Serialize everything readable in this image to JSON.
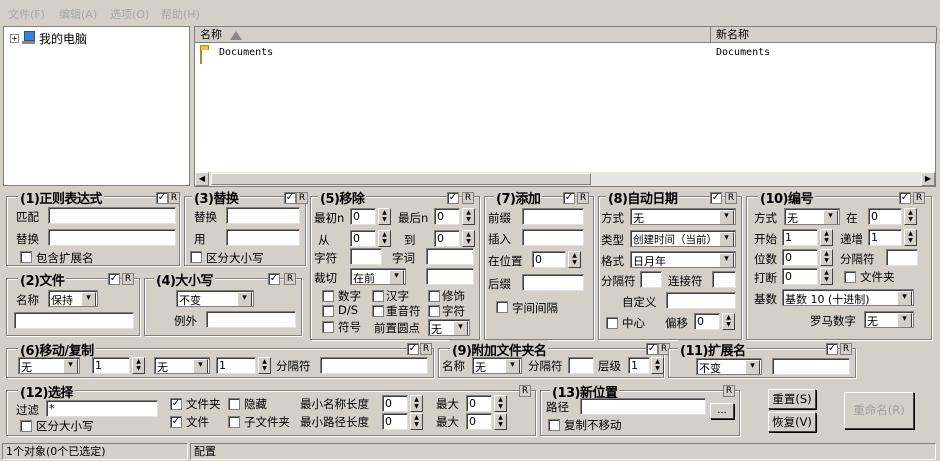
{
  "menu": [
    "文件(F)",
    "编辑(A)",
    "选项(O)",
    "帮助(H)"
  ],
  "tree": {
    "root": "我的电脑",
    "expander": "+"
  },
  "list": {
    "col_name": "名称",
    "col_newname": "新名称",
    "rows": [
      {
        "name": "Documents",
        "newname": "Documents"
      }
    ]
  },
  "regex": {
    "title": "(1)正则表达式",
    "match": "匹配",
    "replace": "替换",
    "incl_ext": "包含扩展名",
    "r": "R"
  },
  "file": {
    "title": "(2)文件",
    "name_label": "名称",
    "name_value": "保持",
    "r": "R"
  },
  "repl": {
    "title": "(3)替换",
    "replace": "替换",
    "with": "用",
    "case": "区分大小写",
    "r": "R"
  },
  "case": {
    "title": "(4)大小写",
    "value": "不变",
    "except": "例外",
    "r": "R"
  },
  "remove": {
    "title": "(5)移除",
    "first_n": "最初n",
    "last_n": "最后n",
    "from": "从",
    "to": "到",
    "chars": "字符",
    "words": "字词",
    "crop": "裁切",
    "crop_value": "在前",
    "digits": "数字",
    "chinese": "汉字",
    "modifiers": "修饰",
    "ds": "D/S",
    "accents": "重音符",
    "chars2": "字符",
    "symbols": "符号",
    "lead_dots": "前置圆点",
    "lead_dots_value": "无",
    "first_n_val": "0",
    "last_n_val": "0",
    "from_val": "0",
    "to_val": "0",
    "r": "R"
  },
  "add": {
    "title": "(7)添加",
    "prefix": "前缀",
    "insert": "插入",
    "at_pos": "在位置",
    "at_pos_val": "0",
    "suffix": "后缀",
    "word_space": "字间间隔",
    "r": "R"
  },
  "autodate": {
    "title": "(8)自动日期",
    "mode": "方式",
    "mode_val": "无",
    "type": "类型",
    "type_val": "创建时间（当前）",
    "format": "格式",
    "format_val": "日月年",
    "sep": "分隔符",
    "join": "连接符",
    "custom": "自定义",
    "center": "中心",
    "offset": "偏移",
    "offset_val": "0",
    "r": "R"
  },
  "number": {
    "title": "(10)编号",
    "mode": "方式",
    "mode_val": "无",
    "at": "在",
    "at_val": "0",
    "start": "开始",
    "start_val": "1",
    "incr": "递增",
    "incr_val": "1",
    "pad": "位数",
    "pad_val": "0",
    "sep": "分隔符",
    "break": "打断",
    "break_val": "0",
    "folder": "文件夹",
    "base": "基数",
    "base_val": "基数 10 (十进制)",
    "roman": "罗马数字",
    "roman_val": "无",
    "r": "R"
  },
  "move": {
    "title": "(6)移动/复制",
    "sel1": "无",
    "val1": "1",
    "sel2": "无",
    "val2": "1",
    "sep": "分隔符",
    "r": "R"
  },
  "append": {
    "title": "(9)附加文件夹名",
    "name": "名称",
    "name_val": "无",
    "sep": "分隔符",
    "level": "层级",
    "level_val": "1",
    "r": "R"
  },
  "ext": {
    "title": "(11)扩展名",
    "value": "不变",
    "r": "R"
  },
  "select": {
    "title": "(12)选择",
    "filter": "过滤",
    "filter_val": "*",
    "case": "区分大小写",
    "folders": "文件夹",
    "files": "文件",
    "hidden": "隐藏",
    "subfolders": "子文件夹",
    "min_name": "最小名称长度",
    "min_path": "最小路径长度",
    "max": "最大",
    "zero": "0",
    "r": "R"
  },
  "newloc": {
    "title": "(13)新位置",
    "path": "路径",
    "browse": "...",
    "copy": "复制不移动",
    "r": "R"
  },
  "buttons": {
    "reset": "重置(S)",
    "revert": "恢复(V)",
    "rename": "重命名(R)"
  },
  "status": {
    "count": "1个对象(0个已选定)",
    "config": "配置"
  },
  "colors": {
    "face": "#d4d0c8",
    "shadow": "#808080"
  }
}
